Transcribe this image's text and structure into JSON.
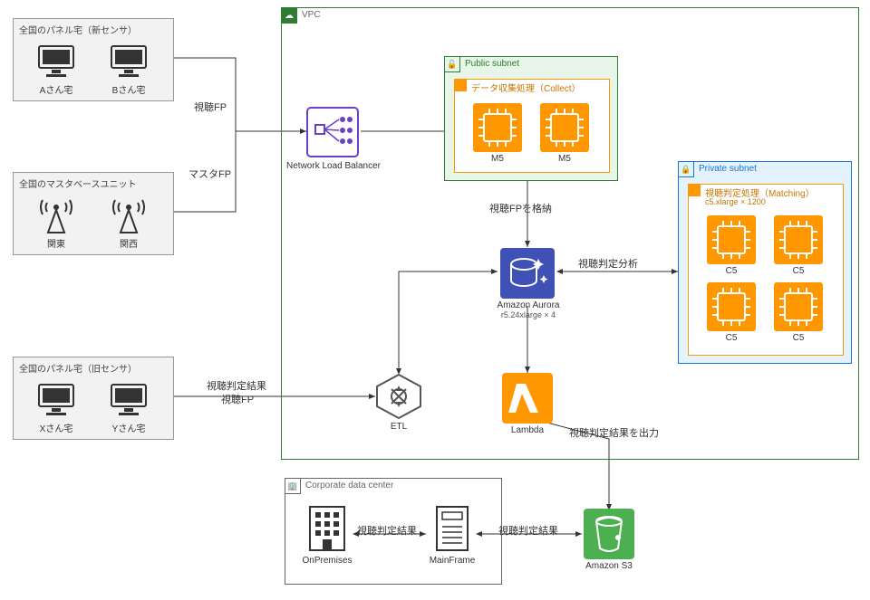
{
  "groups": {
    "panel_new": {
      "title": "全国のパネル宅（新センサ）",
      "house_a": "Aさん宅",
      "house_b": "Bさん宅"
    },
    "master_base": {
      "title": "全国のマスタベースユニット",
      "tower_e": "関東",
      "tower_w": "関西"
    },
    "panel_old": {
      "title": "全国のパネル宅（旧センサ）",
      "house_x": "Xさん宅",
      "house_y": "Yさん宅"
    },
    "vpc": {
      "label": "VPC"
    },
    "public_subnet": {
      "label": "Public subnet"
    },
    "private_subnet": {
      "label": "Private subnet"
    },
    "collect": {
      "label": "データ収集処理（Collect）",
      "m5": "M5"
    },
    "matching": {
      "label": "視聴判定処理（Matching）",
      "sub": "c5.xlarge × 1200",
      "c5": "C5"
    },
    "corporate": {
      "label": "Corporate data center"
    }
  },
  "nodes": {
    "nlb": "Network Load Balancer",
    "aurora": {
      "name": "Amazon Aurora",
      "sub": "r5.24xlarge × 4"
    },
    "etl": "ETL",
    "lambda": "Lambda",
    "onprem": "OnPremises",
    "mainframe": "MainFrame",
    "s3": "Amazon S3"
  },
  "edges": {
    "view_fp": "視聴FP",
    "master_fp": "マスタFP",
    "store_fp": "視聴FPを格納",
    "matching_analysis": "視聴判定分析",
    "old_result_line1": "視聴判定結果",
    "old_result_line2": "視聴FP",
    "output_result": "視聴判定結果を出力",
    "result1": "視聴判定結果",
    "result2": "視聴判定結果"
  }
}
